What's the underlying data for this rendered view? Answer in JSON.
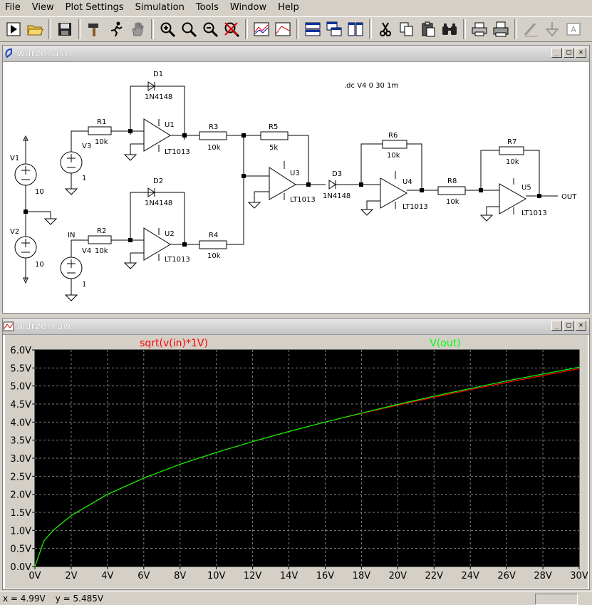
{
  "menubar": {
    "items": [
      "File",
      "View",
      "Plot Settings",
      "Simulation",
      "Tools",
      "Window",
      "Help"
    ]
  },
  "toolbar": {
    "icons": [
      "run-icon",
      "open-folder-icon",
      "save-icon",
      "hammer-icon",
      "running-man-icon",
      "hand-icon",
      "zoom-in-icon",
      "zoom-fit-icon",
      "zoom-out-icon",
      "zoom-cancel-icon",
      "plot-pane-icon",
      "plot-delete-icon",
      "tile-horizontal-icon",
      "cascade-icon",
      "tile-vertical-icon",
      "cut-icon",
      "copy-icon",
      "paste-icon",
      "find-icon",
      "print-setup-icon",
      "print-icon",
      "pencil-icon",
      "ground-icon",
      "label-icon"
    ]
  },
  "schematic_window": {
    "title": "wurzel.asc",
    "directive": ".dc V4 0 30 1m",
    "components": {
      "v1": {
        "name": "V1",
        "value": "10"
      },
      "v2": {
        "name": "V2",
        "value": "10"
      },
      "v3": {
        "name": "V3",
        "value": "1"
      },
      "v4": {
        "name": "V4",
        "value": "1"
      },
      "r1": {
        "name": "R1",
        "value": "10k"
      },
      "r2": {
        "name": "R2",
        "value": "10k"
      },
      "r3": {
        "name": "R3",
        "value": "10k"
      },
      "r4": {
        "name": "R4",
        "value": "10k"
      },
      "r5": {
        "name": "R5",
        "value": "5k"
      },
      "r6": {
        "name": "R6",
        "value": "10k"
      },
      "r7": {
        "name": "R7",
        "value": "10k"
      },
      "r8": {
        "name": "R8",
        "value": "10k"
      },
      "d1": {
        "name": "D1",
        "model": "1N4148"
      },
      "d2": {
        "name": "D2",
        "model": "1N4148"
      },
      "d3": {
        "name": "D3",
        "model": "1N4148"
      },
      "u1": {
        "name": "U1",
        "model": "LT1013"
      },
      "u2": {
        "name": "U2",
        "model": "LT1013"
      },
      "u3": {
        "name": "U3",
        "model": "LT1013"
      },
      "u4": {
        "name": "U4",
        "model": "LT1013"
      },
      "u5": {
        "name": "U5",
        "model": "LT1013"
      }
    },
    "net_labels": {
      "in": "IN",
      "out": "OUT"
    }
  },
  "plot_window": {
    "title": "wurzel.raw"
  },
  "chart_data": {
    "type": "line",
    "title": "",
    "xlabel": "",
    "ylabel": "",
    "xlim": [
      0,
      30
    ],
    "ylim": [
      0,
      6
    ],
    "x_ticks": [
      "0V",
      "2V",
      "4V",
      "6V",
      "8V",
      "10V",
      "12V",
      "14V",
      "16V",
      "18V",
      "20V",
      "22V",
      "24V",
      "26V",
      "28V",
      "30V"
    ],
    "y_ticks": [
      "0.0V",
      "0.5V",
      "1.0V",
      "1.5V",
      "2.0V",
      "2.5V",
      "3.0V",
      "3.5V",
      "4.0V",
      "4.5V",
      "5.0V",
      "5.5V",
      "6.0V"
    ],
    "grid": true,
    "background": "#000000",
    "x": [
      0,
      0.5,
      1,
      2,
      4,
      6,
      8,
      10,
      12,
      14,
      16,
      18,
      20,
      22,
      24,
      26,
      28,
      30
    ],
    "series": [
      {
        "name": "sqrt(v(in)*1V)",
        "color": "#ff0000",
        "values": [
          0,
          0.71,
          1.0,
          1.41,
          2.0,
          2.45,
          2.83,
          3.16,
          3.46,
          3.74,
          4.0,
          4.24,
          4.47,
          4.69,
          4.9,
          5.1,
          5.29,
          5.48
        ]
      },
      {
        "name": "V(out)",
        "color": "#00ff00",
        "values": [
          0,
          0.71,
          1.0,
          1.41,
          2.0,
          2.45,
          2.83,
          3.16,
          3.46,
          3.74,
          4.0,
          4.25,
          4.49,
          4.72,
          4.93,
          5.14,
          5.33,
          5.52
        ]
      }
    ]
  },
  "statusbar": {
    "x_readout": "x = 4.99V",
    "y_readout": "y = 5.485V"
  }
}
